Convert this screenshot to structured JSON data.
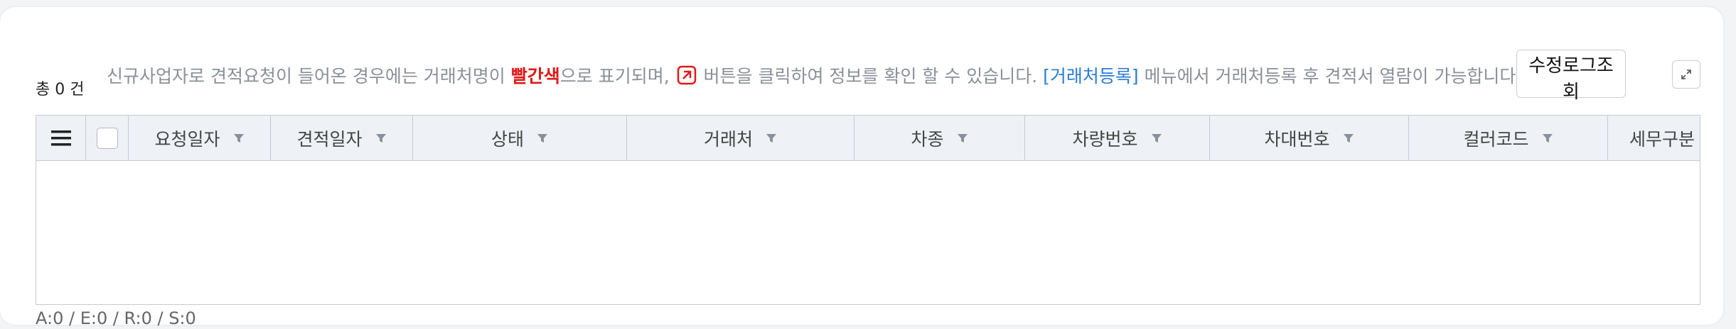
{
  "summary": {
    "total": "총 0 건"
  },
  "notice": {
    "part1": "신규사업자로 견적요청이 들어온 경우에는 거래처명이 ",
    "highlight_red": "빨간색",
    "part2": "으로 표기되며, ",
    "part3": " 버튼을 클릭하여 정보를 확인 할 수 있습니다. ",
    "link": "[거래처등록]",
    "part4": " 메뉴에서 거래처등록 후 견적서 열람이 가능합니다."
  },
  "toolbar": {
    "log_button": "수정로그조회"
  },
  "grid": {
    "columns": [
      "요청일자",
      "견적일자",
      "상태",
      "거래처",
      "차종",
      "차량번호",
      "차대번호",
      "컬러코드",
      "세무구분"
    ]
  },
  "footer": {
    "stats": "A:0 / E:0 / R:0 / S:0"
  },
  "colors": {
    "red": "#e01818",
    "blue": "#2b7bd8",
    "header_bg": "#eef1f5"
  }
}
